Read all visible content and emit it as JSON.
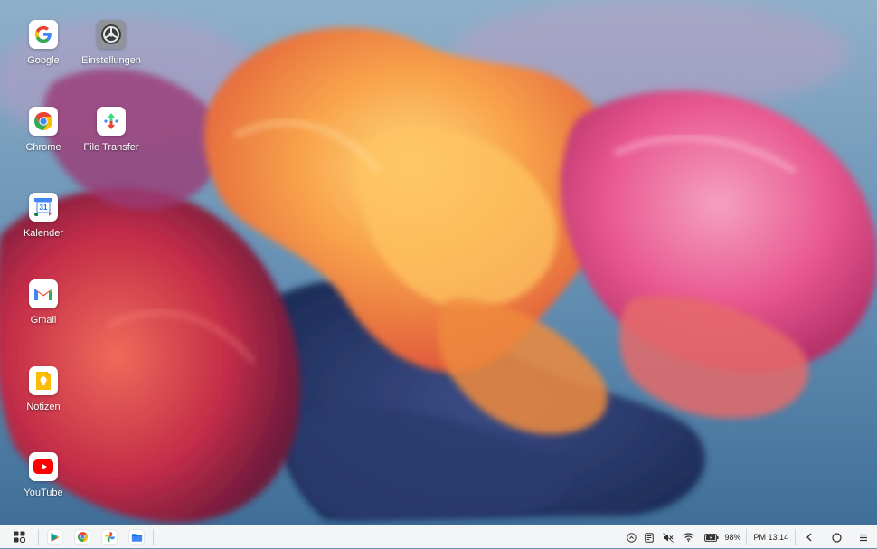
{
  "desktop": {
    "icons": [
      {
        "label": "Google"
      },
      {
        "label": "Einstellungen"
      },
      {
        "label": "Chrome"
      },
      {
        "label": "File Transfer"
      },
      {
        "label": "Kalender",
        "badge": "31"
      },
      {
        "label": "Gmail"
      },
      {
        "label": "Notizen"
      },
      {
        "label": "YouTube"
      }
    ]
  },
  "taskbar": {
    "pinned_apps": [
      "play-store-icon",
      "chrome-icon",
      "photos-icon",
      "files-icon"
    ],
    "tray": {
      "battery_percent": "98%",
      "clock": "PM 13:14"
    }
  },
  "colors": {
    "taskbar_bg": "#f4f5f7",
    "wallpaper_sky": "#6f93b0",
    "accent_orange": "#f7931e",
    "accent_pink": "#e8548a"
  }
}
